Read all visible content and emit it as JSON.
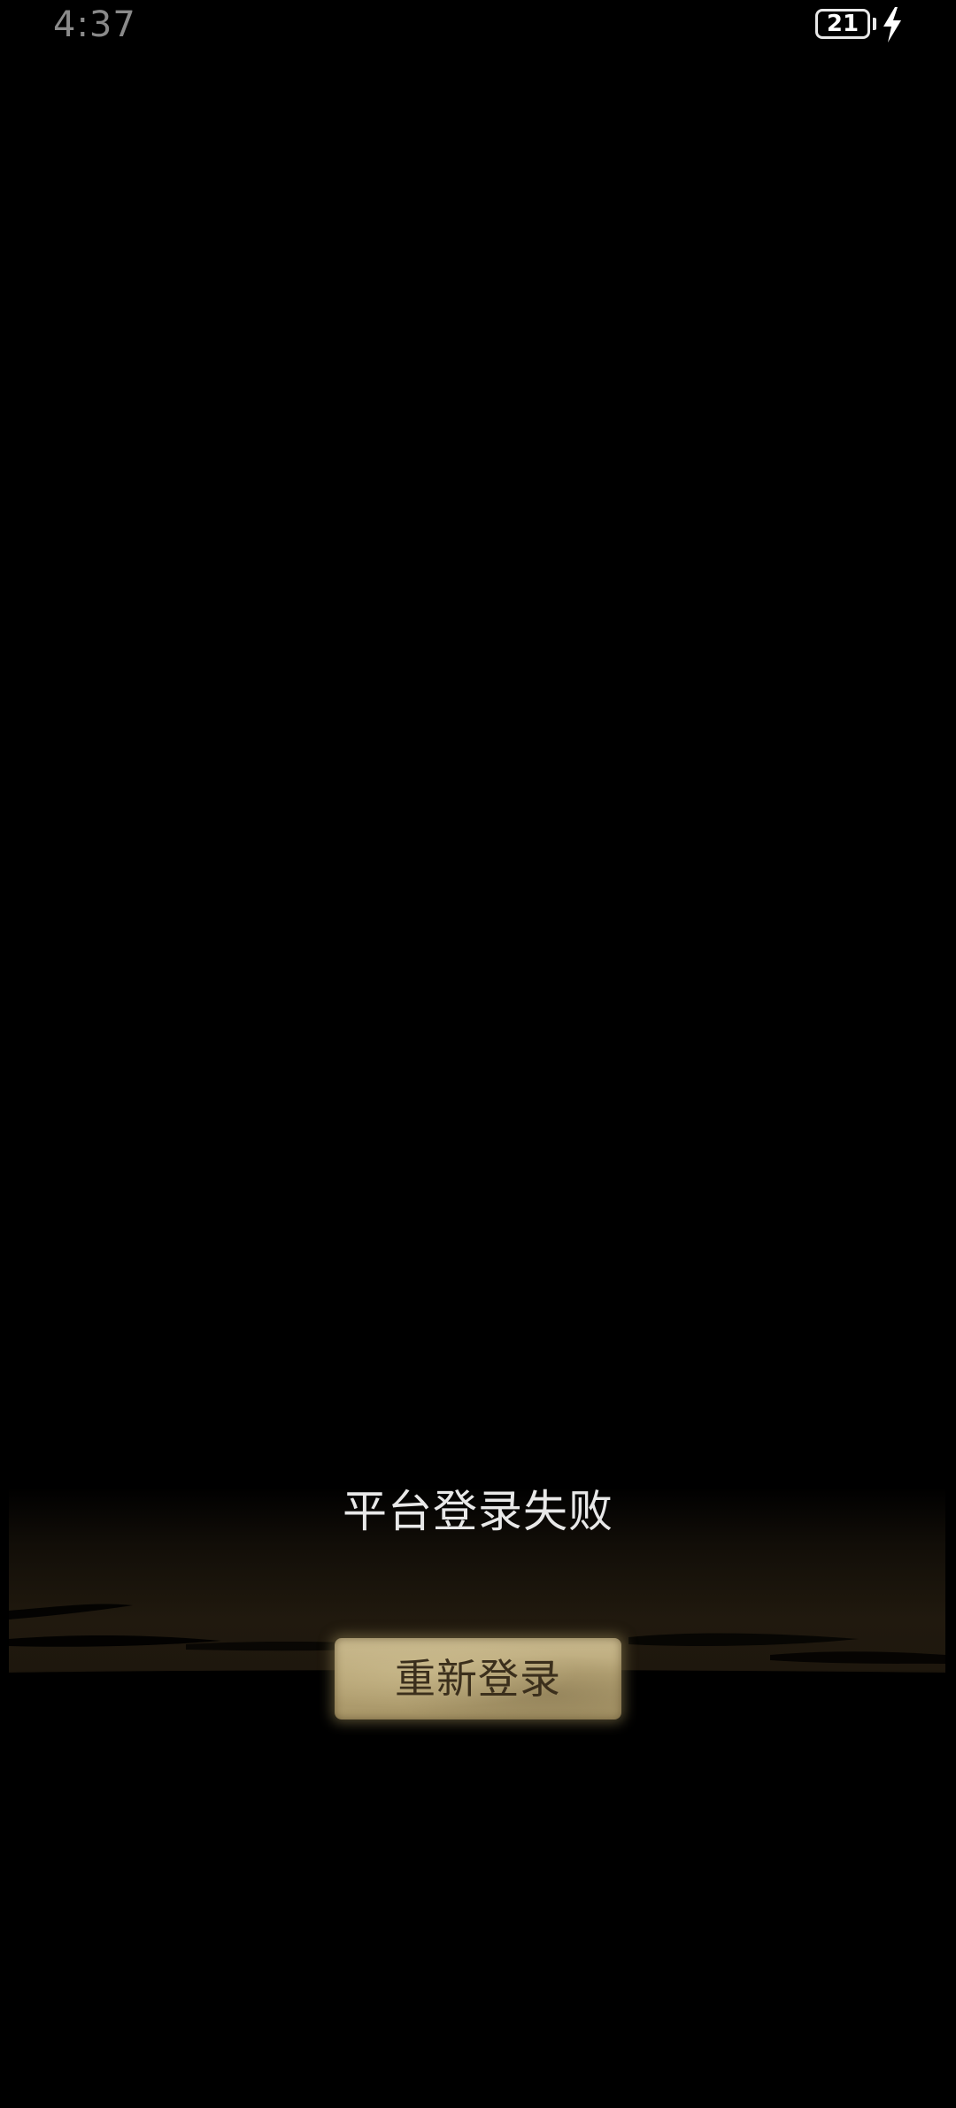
{
  "status_bar": {
    "time": "4:37",
    "battery_level": "21",
    "charging_icon": "lightning-bolt-icon"
  },
  "dialog": {
    "message": "平台登录失败",
    "relogin_button_label": "重新登录"
  },
  "colors": {
    "background": "#000000",
    "message_text": "#e8e8e8",
    "button_face": "#b7a576",
    "button_text": "#3b2f1c"
  }
}
